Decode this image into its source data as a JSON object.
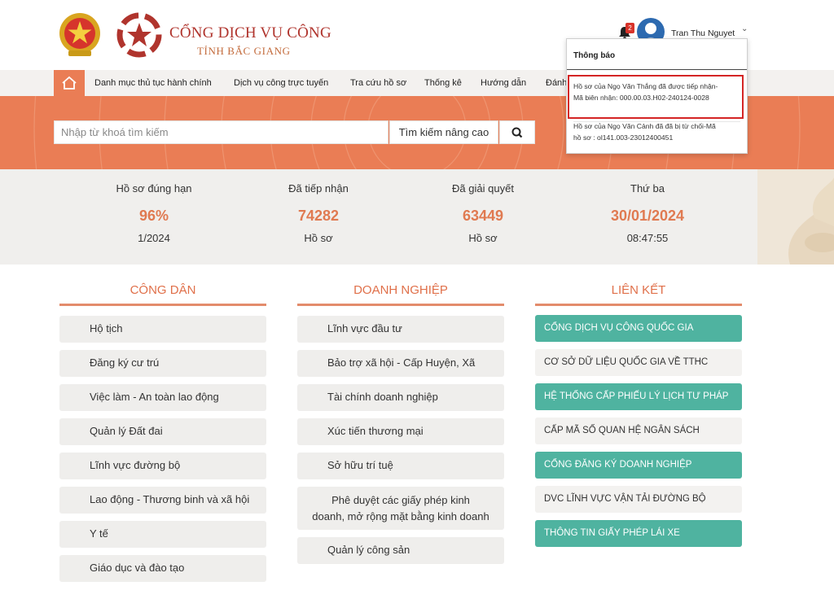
{
  "header": {
    "site_title": "CỔNG DỊCH VỤ CÔNG",
    "site_subtitle": "TỈNH BẮC GIANG",
    "notification_count": "2",
    "user_name": "Tran Thu Nguyet",
    "brand_color": "#b0342d",
    "accent_color": "#ea7d55"
  },
  "nav": {
    "home_icon": "home-icon",
    "items": [
      "Danh mục thủ tục hành chính",
      "Dịch vụ công trực tuyến",
      "Tra cứu hồ sơ",
      "Thống kê",
      "Hướng dẫn",
      "Đánh"
    ]
  },
  "search": {
    "placeholder": "Nhập từ khoá tìm kiếm",
    "advanced_label": "Tìm kiếm nâng cao",
    "button_icon": "search-icon"
  },
  "stats": [
    {
      "label": "Hồ sơ đúng hạn",
      "value": "96%",
      "sub": "1/2024"
    },
    {
      "label": "Đã tiếp nhận",
      "value": "74282",
      "sub": "Hồ sơ"
    },
    {
      "label": "Đã giải quyết",
      "value": "63449",
      "sub": "Hồ sơ"
    },
    {
      "label": "Thứ ba",
      "value": "30/01/2024",
      "sub": "08:47:55"
    }
  ],
  "citizen": {
    "title": "CÔNG DÂN",
    "items": [
      "Hộ tịch",
      "Đăng ký cư trú",
      "Việc làm - An toàn lao động",
      "Quản lý Đất đai",
      "Lĩnh vực đường bộ",
      "Lao động - Thương binh và xã hội",
      "Y tế",
      "Giáo dục và đào tạo"
    ]
  },
  "business": {
    "title": "DOANH NGHIỆP",
    "items": [
      "Lĩnh vực đầu tư",
      "Bảo trợ xã hội - Cấp Huyện, Xã",
      "Tài chính doanh nghiệp",
      "Xúc tiến thương mại",
      "Sở hữu trí tuệ",
      "Phê duyệt các giấy phép kinh",
      "doanh, mở rộng mặt bằng kinh doanh",
      "Quản lý công sản"
    ]
  },
  "links": {
    "title": "LIÊN KẾT",
    "items": [
      "CỔNG DỊCH VỤ CÔNG QUỐC GIA",
      "CƠ SỞ DỮ LIỆU QUỐC GIA VỀ TTHC",
      "HỆ THỐNG CẤP PHIẾU LÝ LỊCH TƯ PHÁP",
      "CẤP MÃ SỐ QUAN HỆ NGÂN SÁCH",
      "CỔNG ĐĂNG KÝ DOANH NGHIỆP",
      "DVC LĨNH VỰC VẬN TẢI ĐƯỜNG BỘ",
      "THÔNG TIN GIẤY PHÉP LÁI XE"
    ]
  },
  "notifications": {
    "title": "Thông báo",
    "items": [
      {
        "line1": "Hồ sơ của Ngọ Văn Thắng đã được tiếp nhận-",
        "line2": "Mã biên nhận: 000.00.03.H02-240124-0028"
      },
      {
        "line1": "Hồ sơ của Ngọ Văn Cảnh đã đã bị từ chối-Mã",
        "line2": "hồ sơ : ol141.003-23012400451"
      }
    ]
  }
}
